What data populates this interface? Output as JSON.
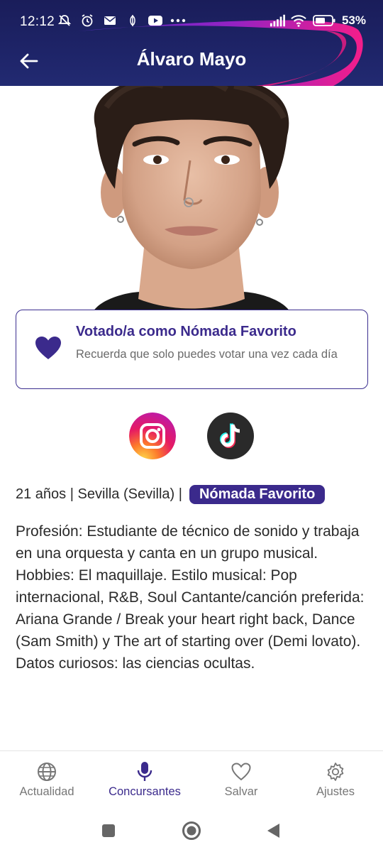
{
  "status_bar": {
    "time": "12:12",
    "battery_percent": "53%",
    "icons_left": [
      "mute-bell-icon",
      "alarm-icon",
      "mail-icon",
      "vpn-key-icon",
      "youtube-icon",
      "more-dots-icon"
    ],
    "icons_right": [
      "signal-icon",
      "wifi-icon",
      "battery-icon"
    ]
  },
  "app_bar": {
    "title": "Álvaro Mayo",
    "back_icon": "arrow-left-icon"
  },
  "vote_card": {
    "title": "Votado/a como Nómada Favorito",
    "subtitle": "Recuerda que solo puedes votar una vez cada día",
    "icon": "heart-icon"
  },
  "social": {
    "instagram": "instagram-icon",
    "tiktok": "tiktok-icon"
  },
  "info": {
    "text": "21 años | Sevilla (Sevilla) |",
    "badge": "Nómada Favorito"
  },
  "description": "Profesión: Estudiante de técnico de sonido y trabaja en una orquesta y canta en un grupo musical. Hobbies: El maquillaje. Estilo musical: Pop internacional, R&B, Soul Cantante/canción preferida: Ariana Grande / Break your heart right back, Dance (Sam Smith) y The art of starting over (Demi lovato). Datos curiosos: las ciencias ocultas.",
  "bottom_nav": {
    "items": [
      {
        "label": "Actualidad",
        "icon": "globe-icon",
        "active": false
      },
      {
        "label": "Concursantes",
        "icon": "microphone-icon",
        "active": true
      },
      {
        "label": "Salvar",
        "icon": "heart-outline-icon",
        "active": false
      },
      {
        "label": "Ajustes",
        "icon": "gear-icon",
        "active": false
      }
    ]
  },
  "colors": {
    "brand_purple": "#3b2a8c",
    "header_navy": "#1e2468",
    "swoosh_magenta": "#e0109a"
  }
}
